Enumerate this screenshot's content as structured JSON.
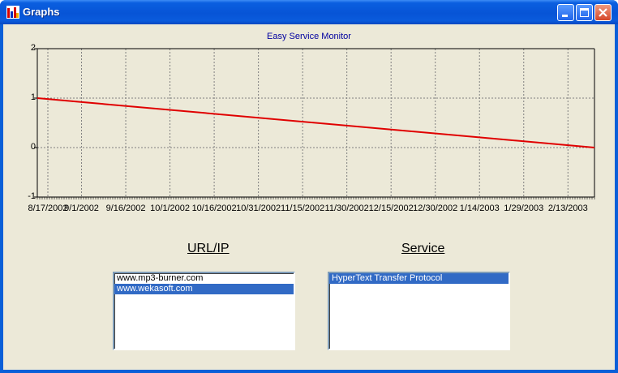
{
  "window": {
    "title": "Graphs",
    "icon": "bar-chart-icon",
    "buttons": [
      "minimize-icon",
      "maximize-icon",
      "close-icon"
    ]
  },
  "chart_data": {
    "type": "line",
    "title": "Easy Service Monitor",
    "y_ticks": [
      "2",
      "1",
      "0",
      "-1"
    ],
    "ylim": [
      -1,
      2
    ],
    "x_ticks": [
      "8/17/2002",
      "9/1/2002",
      "9/16/2002",
      "10/1/2002",
      "10/16/2002",
      "10/31/2002",
      "11/15/2002",
      "11/30/2002",
      "12/15/2002",
      "12/30/2002",
      "1/14/2003",
      "1/29/2003",
      "2/13/2003"
    ],
    "series": [
      {
        "color": "#e00000",
        "x": [
          "8/17/2002",
          "2/22/2003"
        ],
        "y": [
          1,
          0
        ]
      }
    ],
    "grid": true,
    "grid_style": "dashed"
  },
  "url_panel": {
    "header": "URL/IP",
    "items": [
      "www.mp3-burner.com",
      "www.wekasoft.com"
    ],
    "selected_index": 1
  },
  "service_panel": {
    "header": "Service",
    "items": [
      "HyperText Transfer Protocol"
    ],
    "selected_index": 0
  }
}
